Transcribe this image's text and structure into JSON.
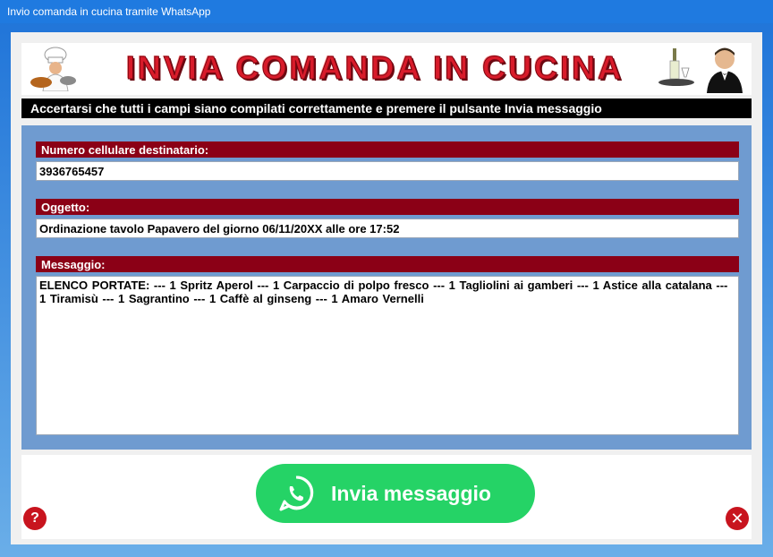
{
  "window": {
    "title": "Invio comanda in cucina tramite WhatsApp"
  },
  "banner": {
    "title": "INVIA COMANDA IN CUCINA"
  },
  "instruction": "Accertarsi che tutti i campi siano compilati correttamente e premere il pulsante Invia messaggio",
  "fields": {
    "phone": {
      "label": "Numero cellulare destinatario:",
      "value": "3936765457"
    },
    "subject": {
      "label": "Oggetto:",
      "value": "Ordinazione tavolo Papavero del giorno 06/11/20XX alle ore 17:52"
    },
    "message": {
      "label": "Messaggio:",
      "value": "ELENCO PORTATE: --- 1   Spritz Aperol --- 1   Carpaccio di polpo fresco --- 1   Tagliolini ai gamberi --- 1   Astice alla catalana --- 1   Tiramisù --- 1   Sagrantino --- 1   Caffè al ginseng --- 1   Amaro Vernelli"
    }
  },
  "actions": {
    "send_label": "Invia messaggio",
    "help_label": "?",
    "close_label": "✕"
  },
  "colors": {
    "accent_label_bg": "#8b0016",
    "panel_bg": "#6f9bd0",
    "whatsapp_green": "#25d366",
    "icon_red": "#c8141e"
  },
  "icons": {
    "chef": "chef-icon",
    "waiter": "waiter-icon",
    "whatsapp": "whatsapp-icon",
    "help": "help-icon",
    "close": "close-icon"
  }
}
